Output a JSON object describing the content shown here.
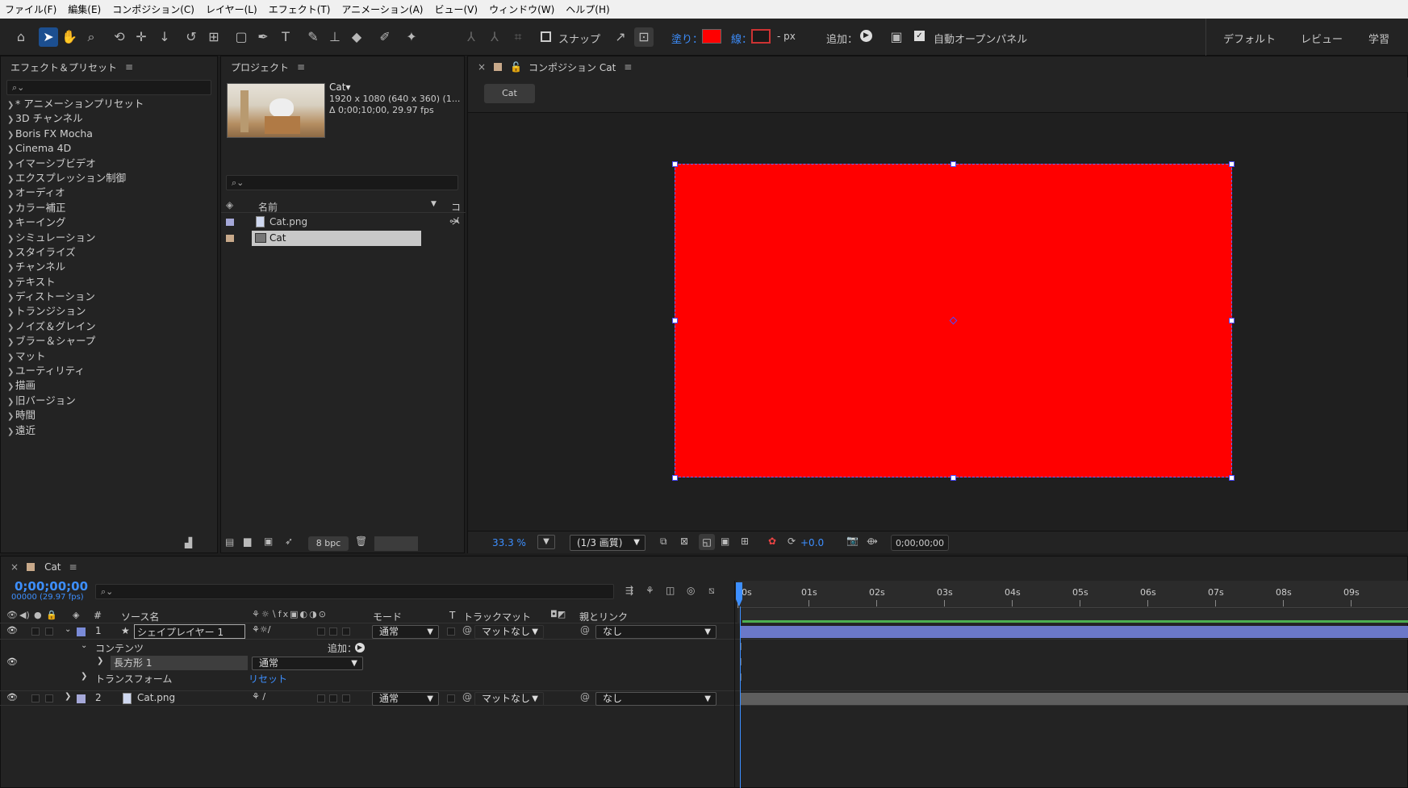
{
  "menu": [
    "ファイル(F)",
    "編集(E)",
    "コンポジション(C)",
    "レイヤー(L)",
    "エフェクト(T)",
    "アニメーション(A)",
    "ビュー(V)",
    "ウィンドウ(W)",
    "ヘルプ(H)"
  ],
  "toolbar": {
    "snap_label": "スナップ",
    "fill_label": "塗り：",
    "stroke_label": "線：",
    "px_label": "- px",
    "add_label": "追加：",
    "auto_open_label": "自動オープンパネル",
    "workspaces": [
      "デフォルト",
      "レビュー",
      "学習"
    ],
    "fill_color": "#ff0000"
  },
  "effects_panel": {
    "title": "エフェクト＆プリセット",
    "items": [
      "* アニメーションプリセット",
      "3D チャンネル",
      "Boris FX Mocha",
      "Cinema 4D",
      "イマーシブビデオ",
      "エクスプレッション制御",
      "オーディオ",
      "カラー補正",
      "キーイング",
      "シミュレーション",
      "スタイライズ",
      "チャンネル",
      "テキスト",
      "ディストーション",
      "トランジション",
      "ノイズ＆グレイン",
      "ブラー＆シャープ",
      "マット",
      "ユーティリティ",
      "描画",
      "旧バージョン",
      "時間",
      "遠近"
    ]
  },
  "project_panel": {
    "title": "プロジェクト",
    "comp_name": "Cat▾",
    "comp_info1": "1920 x 1080  (640 x 360) (1...",
    "comp_info2": "Δ 0;00;10;00, 29.97 fps",
    "col_name": "名前",
    "col_comment": "コメ",
    "items": [
      "Cat.png",
      "Cat"
    ],
    "bpc": "8 bpc"
  },
  "comp_panel": {
    "title": "コンポジション Cat",
    "tab": "Cat",
    "zoom": "33.3 %",
    "quality": "(1/3 画質)",
    "exposure": "+0.0",
    "timecode": "0;00;00;00",
    "shape_color": "#ff0000"
  },
  "timeline": {
    "tab": "Cat",
    "timecode": "0;00;00;00",
    "fps": "00000 (29.97 fps)",
    "col_num": "#",
    "col_source": "ソース名",
    "col_mode": "モード",
    "col_t": "T",
    "col_trackmatte": "トラックマット",
    "col_parent": "親とリンク",
    "ruler": [
      "00s",
      "01s",
      "02s",
      "03s",
      "04s",
      "05s",
      "06s",
      "07s",
      "08s",
      "09s"
    ],
    "layer1": {
      "num": "1",
      "name": "シェイプレイヤー 1",
      "mode": "通常",
      "matte": "マットなし",
      "parent": "なし"
    },
    "contents_label": "コンテンツ",
    "add_label": "追加：",
    "rect_label": "長方形 1",
    "rect_mode": "通常",
    "transform_label": "トランスフォーム",
    "reset_label": "リセット",
    "layer2": {
      "num": "2",
      "name": "Cat.png",
      "mode": "通常",
      "matte": "マットなし",
      "parent": "なし"
    }
  }
}
